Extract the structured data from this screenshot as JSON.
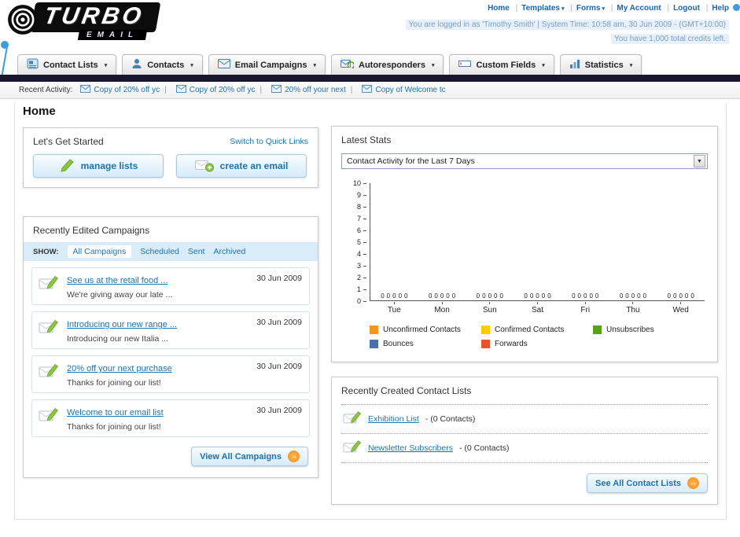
{
  "icons": {
    "dropdown_caret": "▾",
    "select_arrow": "▼",
    "arrow_right": "→"
  },
  "header": {
    "logo_title": "TURBO",
    "logo_subtitle": "EMAIL",
    "nav_links": [
      "Home",
      "Templates",
      "Forms",
      "My Account",
      "Logout",
      "Help"
    ],
    "login_text": "You are logged in as 'Timothy Smith' | System Time: 10:58 am, 30 Jun 2009 - (GMT+10:00)",
    "credits_text": "You have 1,000 total credits left."
  },
  "nav": {
    "tabs": [
      {
        "label": "Contact Lists"
      },
      {
        "label": "Contacts"
      },
      {
        "label": "Email Campaigns"
      },
      {
        "label": "Autoresponders"
      },
      {
        "label": "Custom Fields"
      },
      {
        "label": "Statistics"
      }
    ]
  },
  "recent_activity": {
    "label": "Recent Activity:",
    "items": [
      "Copy of 20% off yc",
      "Copy of 20% off yc",
      "20% off your next",
      "Copy of Welcome tc"
    ]
  },
  "page_title": "Home",
  "get_started": {
    "title": "Let's Get Started",
    "switch_link": "Switch to Quick Links",
    "manage_lists_button": "manage lists",
    "create_email_button": "create an email"
  },
  "campaigns": {
    "title": "Recently Edited Campaigns",
    "show_label": "SHOW:",
    "filters": [
      "All Campaigns",
      "Scheduled",
      "Sent",
      "Archived"
    ],
    "active_filter": "All Campaigns",
    "items": [
      {
        "title": "See us at the retail food ...",
        "subtitle": "We're giving away our late ...",
        "date": "30 Jun 2009"
      },
      {
        "title": "Introducing our new range ...",
        "subtitle": "Introducing our new Italia ...",
        "date": "30 Jun 2009"
      },
      {
        "title": "20% off your next purchase",
        "subtitle": "Thanks for joining our list!",
        "date": "30 Jun 2009"
      },
      {
        "title": "Welcome to our email list",
        "subtitle": "Thanks for joining our list!",
        "date": "30 Jun 2009"
      }
    ],
    "view_all_button": "View All Campaigns"
  },
  "stats": {
    "title": "Latest Stats",
    "dropdown_value": "Contact Activity for the Last 7 Days"
  },
  "chart_data": {
    "type": "bar",
    "title": "Contact Activity for the Last 7 Days",
    "categories": [
      "Tue",
      "Mon",
      "Sun",
      "Sat",
      "Fri",
      "Thu",
      "Wed"
    ],
    "series": [
      {
        "name": "Unconfirmed Contacts",
        "color": "#f7941d",
        "values": [
          0,
          0,
          0,
          0,
          0,
          0,
          0
        ]
      },
      {
        "name": "Confirmed Contacts",
        "color": "#ffcc00",
        "values": [
          0,
          0,
          0,
          0,
          0,
          0,
          0
        ]
      },
      {
        "name": "Unsubscribes",
        "color": "#5aa117",
        "values": [
          0,
          0,
          0,
          0,
          0,
          0,
          0
        ]
      },
      {
        "name": "Bounces",
        "color": "#4f6fa8",
        "values": [
          0,
          0,
          0,
          0,
          0,
          0,
          0
        ]
      },
      {
        "name": "Forwards",
        "color": "#e8532a",
        "values": [
          0,
          0,
          0,
          0,
          0,
          0,
          0
        ]
      }
    ],
    "xlabel": "",
    "ylabel": "",
    "ylim": [
      0,
      10
    ],
    "ytick_step": 1,
    "grid": false,
    "legend_position": "bottom"
  },
  "contact_lists": {
    "title": "Recently Created Contact Lists",
    "items": [
      {
        "name": "Exhibition List",
        "suffix": "- (0 Contacts)"
      },
      {
        "name": "Newsletter Subscribers",
        "suffix": "- (0 Contacts)"
      }
    ],
    "see_all_button": "See All Contact Lists"
  }
}
